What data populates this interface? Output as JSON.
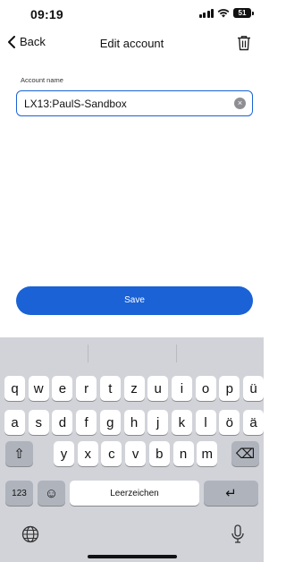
{
  "status": {
    "time": "09:19",
    "battery": "51"
  },
  "nav": {
    "back_label": "Back",
    "title": "Edit account"
  },
  "form": {
    "label": "Account name",
    "value": "LX13:PaulS-Sandbox",
    "clear_glyph": "×"
  },
  "actions": {
    "save_label": "Save"
  },
  "keyboard": {
    "row1": [
      "q",
      "w",
      "e",
      "r",
      "t",
      "z",
      "u",
      "i",
      "o",
      "p",
      "ü"
    ],
    "row2": [
      "a",
      "s",
      "d",
      "f",
      "g",
      "h",
      "j",
      "k",
      "l",
      "ö",
      "ä"
    ],
    "row3": [
      "y",
      "x",
      "c",
      "v",
      "b",
      "n",
      "m"
    ],
    "numbers_label": "123",
    "emoji_glyph": "☺",
    "space_label": "Leerzeichen",
    "shift_glyph": "⇧",
    "delete_glyph": "⌫",
    "return_glyph": "↵"
  },
  "colors": {
    "accent": "#1a62d6",
    "keyboard_bg": "#d1d3d9",
    "key_dark": "#aeb3bc"
  },
  "icons": [
    "chevron-left-icon",
    "trash-icon",
    "clear-icon",
    "shift-icon",
    "delete-icon",
    "emoji-icon",
    "return-icon",
    "globe-icon",
    "mic-icon",
    "signal-icon",
    "wifi-icon",
    "battery-icon"
  ]
}
